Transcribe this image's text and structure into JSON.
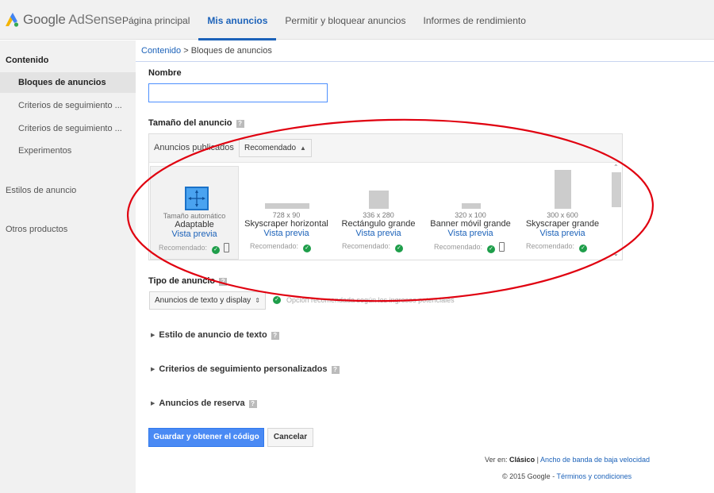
{
  "header": {
    "logo_google": "Google",
    "logo_product": "AdSense",
    "nav": [
      "Página principal",
      "Mis anuncios",
      "Permitir y bloquear anuncios",
      "Informes de rendimiento"
    ]
  },
  "sidebar": {
    "heading": "Contenido",
    "items": [
      "Bloques de anuncios",
      "Criterios de seguimiento ...",
      "Criterios de seguimiento ...",
      "Experimentos"
    ],
    "sections": [
      "Estilos de anuncio",
      "Otros productos"
    ]
  },
  "breadcrumb": {
    "link": "Contenido",
    "separator": " > ",
    "current": "Bloques de anuncios"
  },
  "form": {
    "name_label": "Nombre",
    "name_value": "",
    "size_label": "Tamaño del anuncio",
    "published_label": "Anuncios publicados",
    "published_select": "Recomendado",
    "type_label": "Tipo de anuncio",
    "type_select": "Anuncios de texto y display",
    "type_hint": "Opción recomendada según los ingresos potenciales",
    "help_icon": "?"
  },
  "ad_sizes": [
    {
      "dim": "Tamaño automático",
      "name": "Adaptable",
      "preview": "Vista previa",
      "rec": "Recomendado:"
    },
    {
      "dim": "728 x 90",
      "name": "Skyscraper horizontal",
      "preview": "Vista previa",
      "rec": "Recomendado:"
    },
    {
      "dim": "336 x 280",
      "name": "Rectángulo grande",
      "preview": "Vista previa",
      "rec": "Recomendado:"
    },
    {
      "dim": "320 x 100",
      "name": "Banner móvil grande",
      "preview": "Vista previa",
      "rec": "Recomendado:"
    },
    {
      "dim": "300 x 600",
      "name": "Skyscraper grande",
      "preview": "Vista previa",
      "rec": "Recomendado:"
    }
  ],
  "sections": [
    "Estilo de anuncio de texto",
    "Criterios de seguimiento personalizados",
    "Anuncios de reserva"
  ],
  "buttons": {
    "save": "Guardar y obtener el código",
    "cancel": "Cancelar"
  },
  "footer": {
    "view_label": "Ver en:",
    "view_current": "Clásico",
    "separator": "|",
    "view_alt": "Ancho de banda de baja velocidad",
    "copyright": "© 2015 Google",
    "dash": "-",
    "terms": "Términos y condiciones"
  },
  "colors": {
    "accent": "#1c62b9",
    "primary_button": "#4a8af4",
    "check": "#1e9e4a",
    "annotation": "#e0000f"
  }
}
